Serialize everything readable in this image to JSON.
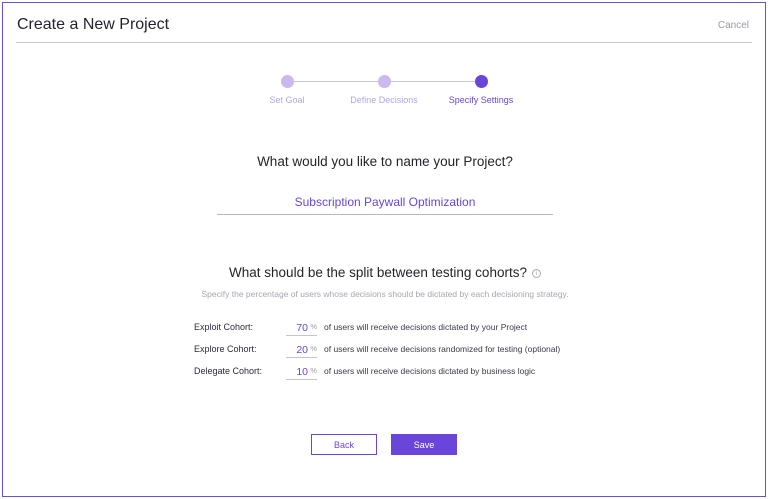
{
  "header": {
    "title": "Create a New Project",
    "cancel_label": "Cancel"
  },
  "stepper": {
    "steps": [
      {
        "label": "Set Goal",
        "state": "done"
      },
      {
        "label": "Define Decisions",
        "state": "done"
      },
      {
        "label": "Specify Settings",
        "state": "active"
      }
    ]
  },
  "name_section": {
    "question": "What would you like to name your Project?",
    "project_name": "Subscription Paywall Optimization"
  },
  "split_section": {
    "question": "What should be the split between testing cohorts?",
    "info_icon": "info-circle-icon",
    "hint": "Specify the percentage of users whose decisions should be dictated by each decisioning strategy.",
    "percent_sign": "%",
    "cohorts": [
      {
        "label": "Exploit Cohort:",
        "value": "70",
        "description": "of users will receive decisions dictated by your Project"
      },
      {
        "label": "Explore Cohort:",
        "value": "20",
        "description": "of users will receive decisions randomized for testing (optional)"
      },
      {
        "label": "Delegate Cohort:",
        "value": "10",
        "description": "of users will receive decisions dictated by business logic"
      }
    ]
  },
  "buttons": {
    "back_label": "Back",
    "save_label": "Save"
  },
  "colors": {
    "accent": "#6a45d9",
    "accent_light": "#c9b9ef",
    "muted_text": "#a7a7b1"
  }
}
